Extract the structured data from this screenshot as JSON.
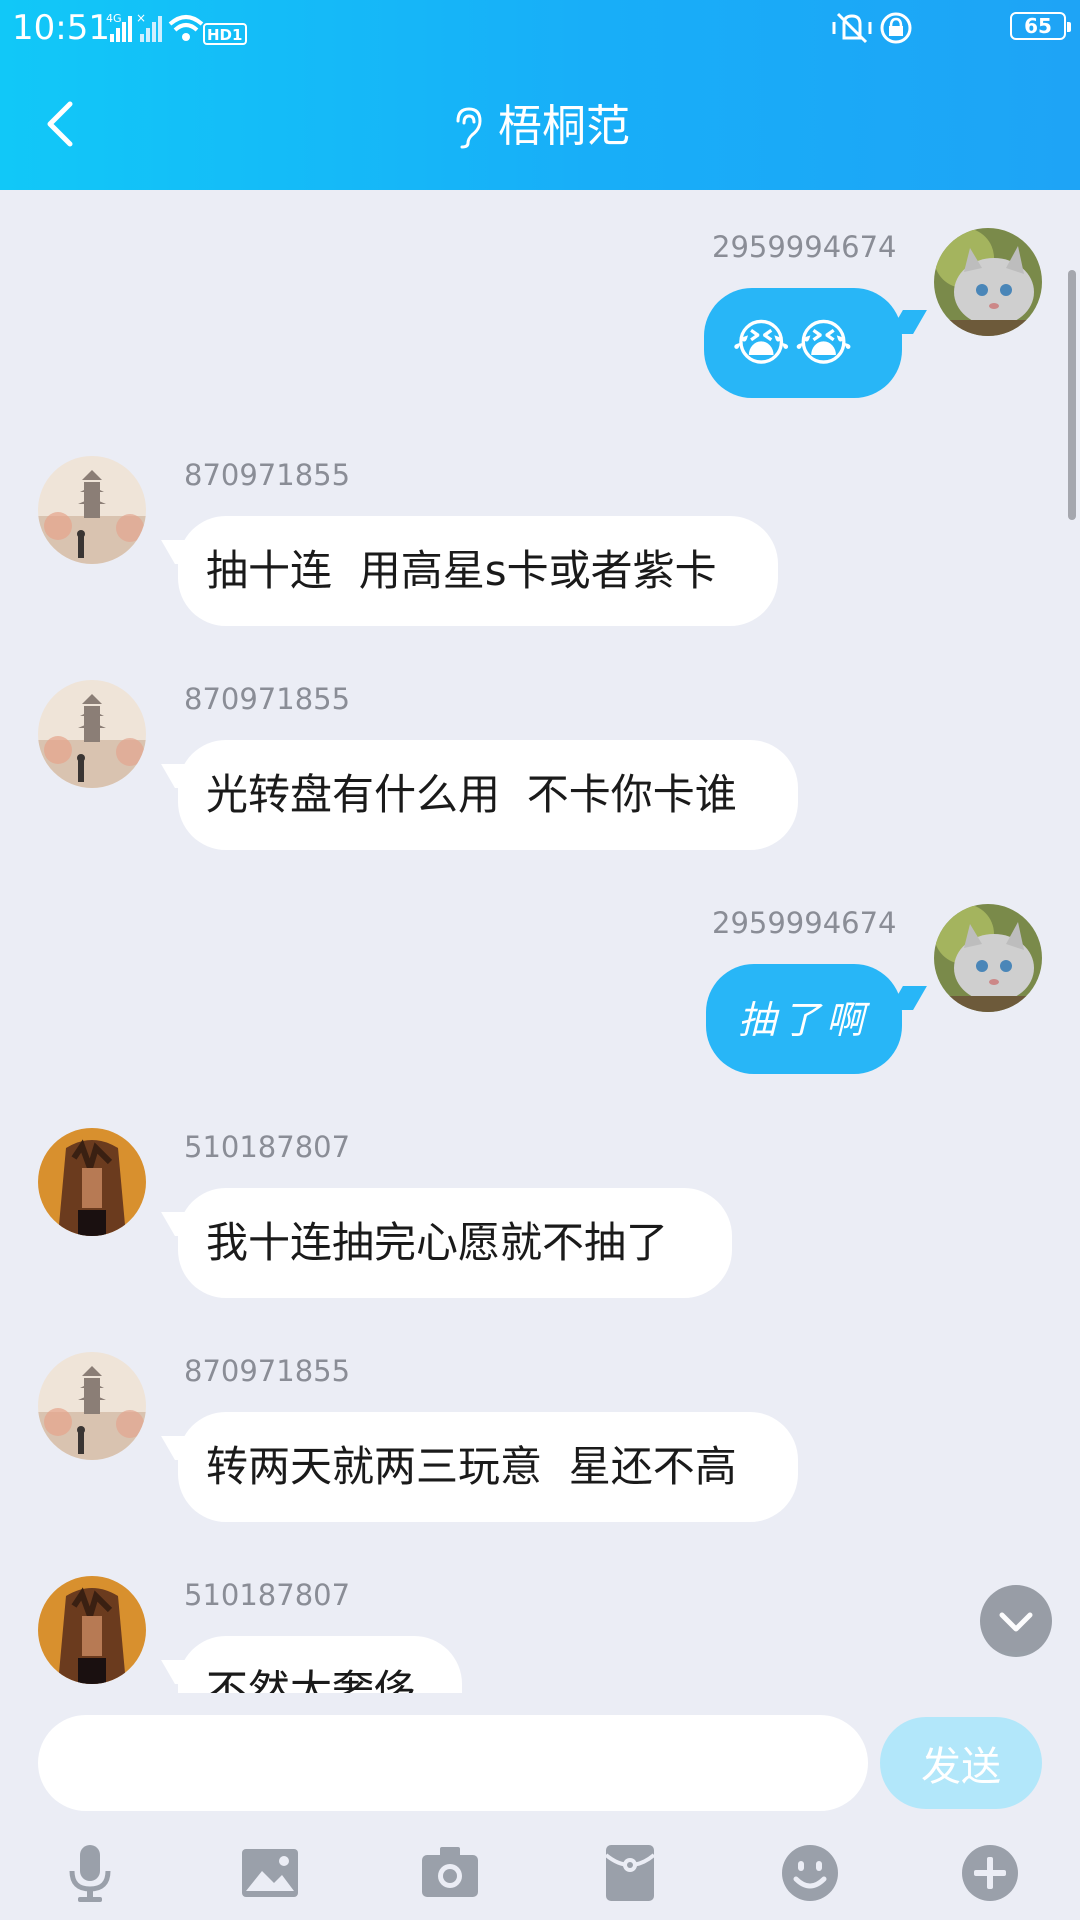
{
  "status_bar": {
    "time": "10:51",
    "network": "4G",
    "battery": "65"
  },
  "header": {
    "title": "梧桐范",
    "back_icon": "chevron-left-icon",
    "ear_icon": "ear-icon"
  },
  "messages": [
    {
      "side": "right",
      "sender": "2959994674",
      "text": "😭😭",
      "kind": "emoji"
    },
    {
      "side": "left",
      "sender": "870971855",
      "text": "抽十连  用高星s卡或者紫卡"
    },
    {
      "side": "left",
      "sender": "870971855",
      "text": "光转盘有什么用  不卡你卡谁"
    },
    {
      "side": "right",
      "sender": "2959994674",
      "text": "抽了啊",
      "kind": "script"
    },
    {
      "side": "left",
      "sender": "510187807",
      "text": "我十连抽完心愿就不抽了"
    },
    {
      "side": "left",
      "sender": "870971855",
      "text": "转两天就两三玩意  星还不高"
    },
    {
      "side": "left",
      "sender": "510187807",
      "text": "不然太奢侈"
    }
  ],
  "input": {
    "value": "",
    "placeholder": "",
    "send_label": "发送"
  },
  "toolbar": [
    "microphone-icon",
    "image-icon",
    "camera-icon",
    "red-packet-icon",
    "emoji-icon",
    "plus-icon"
  ],
  "colors": {
    "header": "#18aef8",
    "bubble_right": "#28b6f7",
    "background": "#ebedf5",
    "send_disabled": "#b2e7fa"
  }
}
